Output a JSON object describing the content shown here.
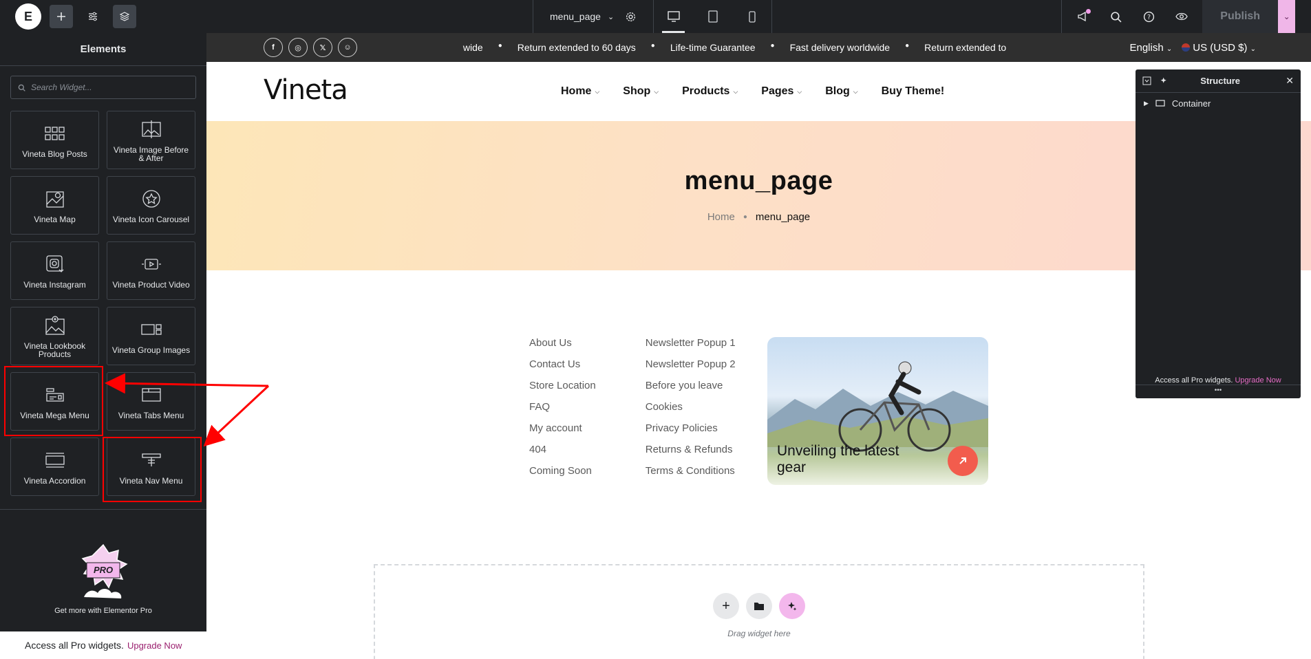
{
  "topbar": {
    "page_name": "menu_page",
    "publish_label": "Publish",
    "colors": {
      "bg": "#1f2124",
      "accent": "#f0b6e8"
    }
  },
  "left_panel": {
    "title": "Elements",
    "search_placeholder": "Search Widget...",
    "widgets": [
      {
        "label": "Vineta Blog Posts",
        "icon": "grid-icon"
      },
      {
        "label": "Vineta Image Before & After",
        "icon": "image-compare-icon"
      },
      {
        "label": "Vineta Map",
        "icon": "map-icon"
      },
      {
        "label": "Vineta Icon Carousel",
        "icon": "star-icon"
      },
      {
        "label": "Vineta Instagram",
        "icon": "instagram-icon"
      },
      {
        "label": "Vineta Product Video",
        "icon": "video-icon"
      },
      {
        "label": "Vineta Lookbook Products",
        "icon": "lookbook-icon"
      },
      {
        "label": "Vineta Group Images",
        "icon": "group-images-icon"
      },
      {
        "label": "Vineta Mega Menu",
        "icon": "mega-menu-icon"
      },
      {
        "label": "Vineta Tabs Menu",
        "icon": "tabs-icon"
      },
      {
        "label": "Vineta Accordion",
        "icon": "accordion-icon"
      },
      {
        "label": "Vineta Nav Menu",
        "icon": "nav-menu-icon"
      }
    ],
    "promo_badge": "PRO",
    "promo_text": "Get more with Elementor Pro",
    "bottom_text": "Access all Pro widgets.",
    "bottom_link": "Upgrade Now"
  },
  "site": {
    "socials": [
      "f",
      "◎",
      "𝕏",
      "☺"
    ],
    "announcements": [
      "ldwide",
      "Return extended to 60 days",
      "Life-time Guarantee",
      "Fast delivery worldwide",
      "Return extended to"
    ],
    "language": "English",
    "currency": "US (USD $)",
    "logo": "Vineta",
    "nav": [
      {
        "label": "Home",
        "has_dropdown": true
      },
      {
        "label": "Shop",
        "has_dropdown": true
      },
      {
        "label": "Products",
        "has_dropdown": true
      },
      {
        "label": "Pages",
        "has_dropdown": true
      },
      {
        "label": "Blog",
        "has_dropdown": true
      },
      {
        "label": "Buy Theme!",
        "has_dropdown": false
      }
    ],
    "hero_title": "menu_page",
    "breadcrumb_home": "Home",
    "breadcrumb_current": "menu_page",
    "menu_col_1": [
      "About Us",
      "Contact Us",
      "Store Location",
      "FAQ",
      "My account",
      "404",
      "Coming Soon"
    ],
    "menu_col_2": [
      "Newsletter Popup 1",
      "Newsletter Popup 2",
      "Before you leave",
      "Cookies",
      "Privacy Policies",
      "Returns & Refunds",
      "Terms & Conditions"
    ],
    "card_text": "Unveiling the latest gear",
    "drop_label": "Drag widget here",
    "colors": {
      "announce_bg": "#2f2f2f",
      "card_button": "#f25c4d"
    }
  },
  "structure": {
    "title": "Structure",
    "items": [
      "Container"
    ],
    "footer_text": "Access all Pro widgets.",
    "footer_link": "Upgrade Now"
  }
}
